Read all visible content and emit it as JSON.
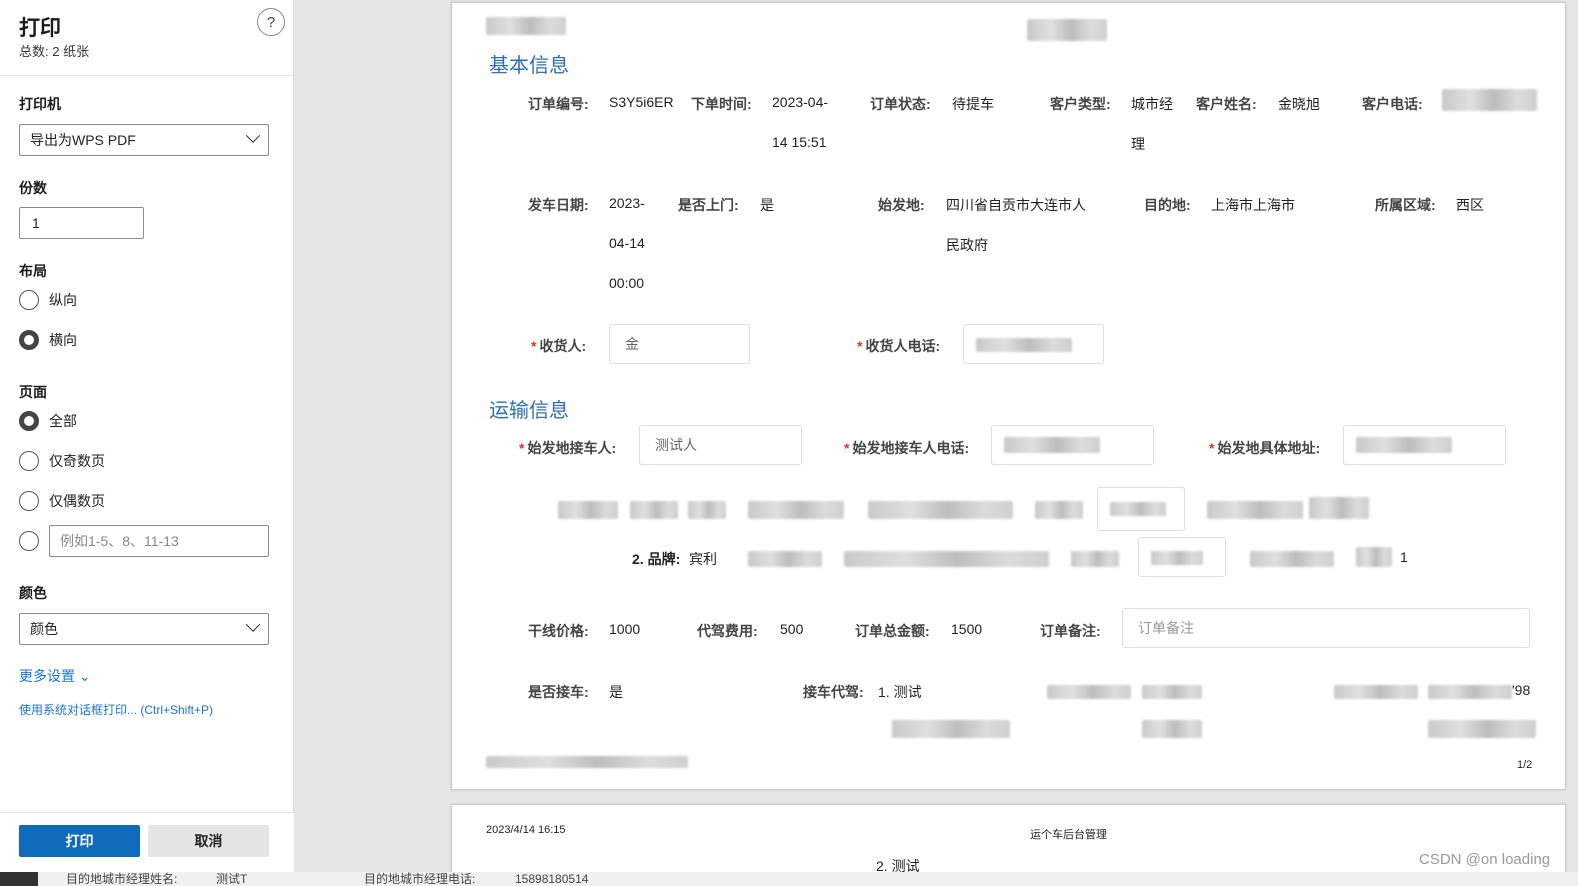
{
  "print_panel": {
    "title": "打印",
    "total_pages": "总数: 2 纸张",
    "help_symbol": "?",
    "printer_label": "打印机",
    "printer_value": "导出为WPS PDF",
    "copies_label": "份数",
    "copies_value": "1",
    "layout_label": "布局",
    "layout_options": [
      "纵向",
      "横向"
    ],
    "layout_selected": "横向",
    "pages_label": "页面",
    "pages_options": [
      "全部",
      "仅奇数页",
      "仅偶数页"
    ],
    "pages_selected": "全部",
    "custom_range_placeholder": "例如1-5、8、11-13",
    "color_label": "颜色",
    "color_value": "颜色",
    "more_settings": "更多设置 ⌄",
    "system_dialog": "使用系统对话框打印... (Ctrl+Shift+P)",
    "print_button": "打印",
    "cancel_button": "取消"
  },
  "preview": {
    "page1": {
      "section_basic": "基本信息",
      "order_no_label": "订单编号:",
      "order_no_value": "S3Y5i6ER",
      "order_time_label": "下单时间:",
      "order_time_value_1": "2023-04-",
      "order_time_value_2": "14 15:51",
      "order_status_label": "订单状态:",
      "order_status_value": "待提车",
      "customer_type_label": "客户类型:",
      "customer_type_value_1": "城市经",
      "customer_type_value_2": "理",
      "customer_name_label": "客户姓名:",
      "customer_name_value": "金晓旭",
      "customer_phone_label": "客户电话:",
      "depart_date_label": "发车日期:",
      "depart_date_value_1": "2023-",
      "depart_date_value_2": "04-14",
      "depart_date_value_3": "00:00",
      "door_label": "是否上门:",
      "door_value": "是",
      "origin_label": "始发地:",
      "origin_value_1": "四川省自贡市大连市人",
      "origin_value_2": "民政府",
      "dest_label": "目的地:",
      "dest_value": "上海市上海市",
      "region_label": "所属区域:",
      "region_value": "西区",
      "receiver_label": "收货人:",
      "receiver_value": "金",
      "receiver_phone_label": "收货人电话:",
      "section_transport": "运输信息",
      "origin_contact_label": "始发地接车人:",
      "origin_contact_value": "测试人",
      "origin_contact_phone_label": "始发地接车人电话:",
      "origin_address_label": "始发地具体地址:",
      "car2_label": "2. 品牌:",
      "car2_value": "宾利",
      "car2_tail": "1",
      "line_price_label": "干线价格:",
      "line_price_value": "1000",
      "driver_fee_label": "代驾费用:",
      "driver_fee_value": "500",
      "total_label": "订单总金额:",
      "total_value": "1500",
      "remark_label": "订单备注:",
      "remark_placeholder": "订单备注",
      "pickup_label": "是否接车:",
      "pickup_value": "是",
      "pickup_driver_label": "接车代驾:",
      "pickup_driver_value": "1. 测试",
      "phone_tail": "'98",
      "page_num": "1/2"
    },
    "page2": {
      "date": "2023/4/14 16:15",
      "site_title": "运个车后台管理",
      "driver_line": "2. 测试"
    }
  },
  "watermark": "CSDN @on loading",
  "bottom_strip": {
    "text_1": "目的地城市经理姓名:",
    "text_2": "测试T",
    "text_3": "目的地城市经理电话:",
    "text_4": "15898180514"
  }
}
